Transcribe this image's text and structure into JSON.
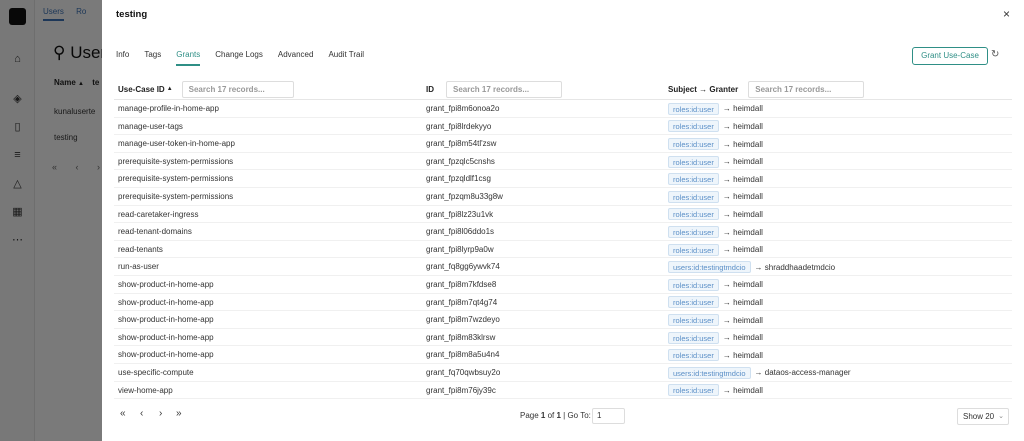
{
  "background": {
    "tabs": [
      "Users",
      "Ro"
    ],
    "title": "User",
    "col_name": "Name",
    "col_te": "te",
    "rows": [
      "kunaluserte",
      "testing"
    ],
    "pager": "« ‹ ›"
  },
  "drawer": {
    "title": "testing",
    "close": "×",
    "tabs": [
      "Info",
      "Tags",
      "Grants",
      "Change Logs",
      "Advanced",
      "Audit Trail"
    ],
    "active_tab": "Grants",
    "grant_button": "Grant Use-Case",
    "refresh": "↻"
  },
  "table": {
    "columns": {
      "usecase": "Use-Case ID",
      "id": "ID",
      "subject": "Subject → Granter"
    },
    "search_placeholder": "Search 17 records...",
    "rows": [
      {
        "usecase": "manage-profile-in-home-app",
        "id": "grant_fpi8m6onoa2o",
        "subject": "roles:id:user",
        "granter": "→ heimdall"
      },
      {
        "usecase": "manage-user-tags",
        "id": "grant_fpi8lrdekyyo",
        "subject": "roles:id:user",
        "granter": "→ heimdall"
      },
      {
        "usecase": "manage-user-token-in-home-app",
        "id": "grant_fpi8m54tl'zsw",
        "subject": "roles:id:user",
        "granter": "→ heimdall"
      },
      {
        "usecase": "prerequisite-system-permissions",
        "id": "grant_fpzqlc5cnshs",
        "subject": "roles:id:user",
        "granter": "→ heimdall"
      },
      {
        "usecase": "prerequisite-system-permissions",
        "id": "grant_fpzqldlf1csg",
        "subject": "roles:id:user",
        "granter": "→ heimdall"
      },
      {
        "usecase": "prerequisite-system-permissions",
        "id": "grant_fpzqm8u33g8w",
        "subject": "roles:id:user",
        "granter": "→ heimdall"
      },
      {
        "usecase": "read-caretaker-ingress",
        "id": "grant_fpi8lz23u1vk",
        "subject": "roles:id:user",
        "granter": "→ heimdall"
      },
      {
        "usecase": "read-tenant-domains",
        "id": "grant_fpi8l06ddo1s",
        "subject": "roles:id:user",
        "granter": "→ heimdall"
      },
      {
        "usecase": "read-tenants",
        "id": "grant_fpi8lyrp9a0w",
        "subject": "roles:id:user",
        "granter": "→ heimdall"
      },
      {
        "usecase": "run-as-user",
        "id": "grant_fq8gg6ywvk74",
        "subject": "users:id:testingtmdcio",
        "granter": "→ shraddhaadetmdcio"
      },
      {
        "usecase": "show-product-in-home-app",
        "id": "grant_fpi8m7kfdse8",
        "subject": "roles:id:user",
        "granter": "→ heimdall"
      },
      {
        "usecase": "show-product-in-home-app",
        "id": "grant_fpi8m7qt4g74",
        "subject": "roles:id:user",
        "granter": "→ heimdall"
      },
      {
        "usecase": "show-product-in-home-app",
        "id": "grant_fpi8m7wzdeyo",
        "subject": "roles:id:user",
        "granter": "→ heimdall"
      },
      {
        "usecase": "show-product-in-home-app",
        "id": "grant_fpi8m83klrsw",
        "subject": "roles:id:user",
        "granter": "→ heimdall"
      },
      {
        "usecase": "show-product-in-home-app",
        "id": "grant_fpi8m8a5u4n4",
        "subject": "roles:id:user",
        "granter": "→ heimdall"
      },
      {
        "usecase": "use-specific-compute",
        "id": "grant_fq70qwbsuy2o",
        "subject": "users:id:testingtmdcio",
        "granter": "→ dataos-access-manager"
      },
      {
        "usecase": "view-home-app",
        "id": "grant_fpi8m76jy39c",
        "subject": "roles:id:user",
        "granter": "→ heimdall"
      }
    ]
  },
  "footer": {
    "first": "«",
    "prev": "‹",
    "next": "›",
    "last": "»",
    "page_prefix": "Page ",
    "page_current": "1",
    "page_of": " of ",
    "page_total": "1",
    "goto_label": " | Go To: ",
    "goto_value": "1",
    "show": "Show 20",
    "chevron": "⌄"
  },
  "colors": {
    "accent": "#2f8f86",
    "pill_text": "#5b8fc7"
  }
}
